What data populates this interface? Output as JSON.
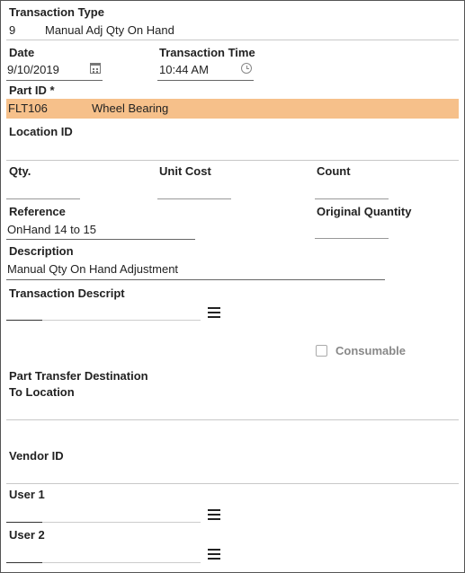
{
  "transaction_type": {
    "label": "Transaction Type",
    "code": "9",
    "name": "Manual Adj Qty On Hand"
  },
  "date": {
    "label": "Date",
    "value": "9/10/2019"
  },
  "time": {
    "label": "Transaction Time",
    "value": "10:44 AM"
  },
  "part": {
    "label": "Part ID *",
    "id": "FLT106",
    "name": "Wheel Bearing",
    "highlight_color": "#f6c08a"
  },
  "location": {
    "label": "Location ID"
  },
  "qty": {
    "label": "Qty."
  },
  "unit_cost": {
    "label": "Unit Cost"
  },
  "count": {
    "label": "Count"
  },
  "reference": {
    "label": "Reference",
    "value": "OnHand 14 to 15"
  },
  "original_quantity": {
    "label": "Original Quantity"
  },
  "description": {
    "label": "Description",
    "value": "Manual Qty On Hand Adjustment"
  },
  "transaction_descript": {
    "label": "Transaction Descript"
  },
  "consumable": {
    "label": "Consumable",
    "checked": false
  },
  "transfer": {
    "label_line1": "Part Transfer Destination",
    "label_line2": "To Location"
  },
  "vendor": {
    "label": "Vendor ID"
  },
  "user1": {
    "label": "User 1"
  },
  "user2": {
    "label": "User 2"
  },
  "icons": {
    "calendar": "calendar-icon",
    "clock": "clock-icon",
    "menu": "menu-icon"
  }
}
